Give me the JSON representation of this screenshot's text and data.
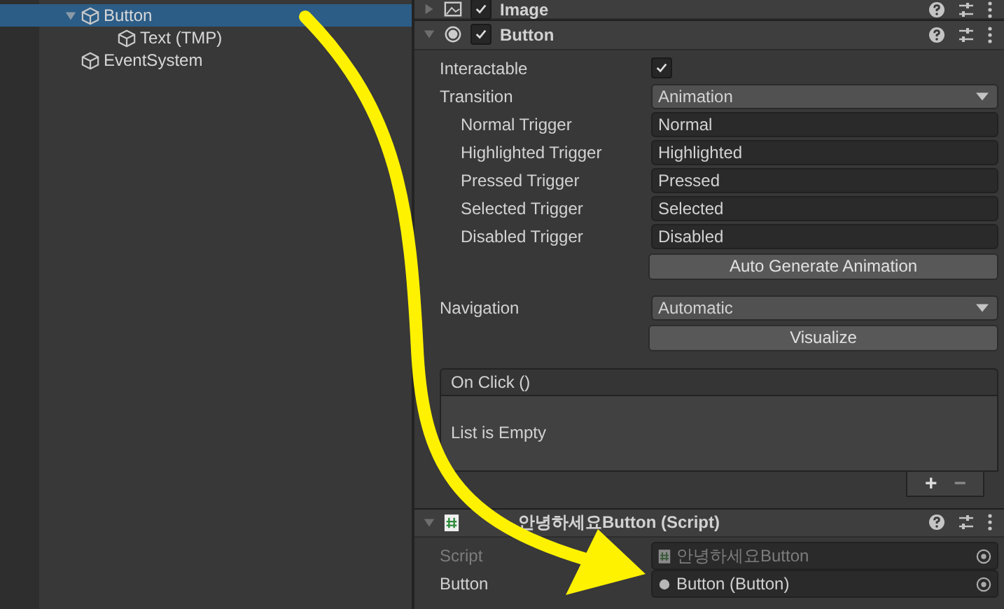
{
  "hierarchy": {
    "items": [
      {
        "label": "Button",
        "selected": true,
        "expanded": true,
        "children": [
          {
            "label": "Text (TMP)",
            "selected": false
          }
        ]
      },
      {
        "label": "EventSystem",
        "selected": false
      }
    ]
  },
  "inspector": {
    "components": [
      {
        "kind": "image",
        "title": "Image",
        "enabled": true,
        "expanded": false
      },
      {
        "kind": "button",
        "title": "Button",
        "enabled": true,
        "expanded": true,
        "fields": [
          {
            "kind": "checkbox",
            "label": "Interactable",
            "checked": true
          },
          {
            "kind": "dropdown",
            "label": "Transition",
            "value": "Animation"
          },
          {
            "kind": "trigger",
            "label": "Normal Trigger",
            "value": "Normal"
          },
          {
            "kind": "trigger",
            "label": "Highlighted Trigger",
            "value": "Highlighted"
          },
          {
            "kind": "trigger",
            "label": "Pressed Trigger",
            "value": "Pressed"
          },
          {
            "kind": "trigger",
            "label": "Selected Trigger",
            "value": "Selected"
          },
          {
            "kind": "trigger",
            "label": "Disabled Trigger",
            "value": "Disabled"
          },
          {
            "kind": "action",
            "text": "Auto Generate Animation"
          },
          {
            "kind": "dropdown",
            "label": "Navigation",
            "value": "Automatic"
          },
          {
            "kind": "action",
            "text": "Visualize"
          },
          {
            "kind": "event",
            "title": "On Click ()",
            "empty_text": "List is Empty",
            "add": "+",
            "remove": "−"
          }
        ]
      },
      {
        "kind": "script",
        "title": "안녕하세요Button (Script)",
        "expanded": true,
        "fields": [
          {
            "kind": "object",
            "label": "Script",
            "value": "안녕하세요Button",
            "disabled": true
          },
          {
            "kind": "object",
            "label": "Button",
            "value": "Button (Button)",
            "disabled": false
          }
        ]
      }
    ]
  }
}
